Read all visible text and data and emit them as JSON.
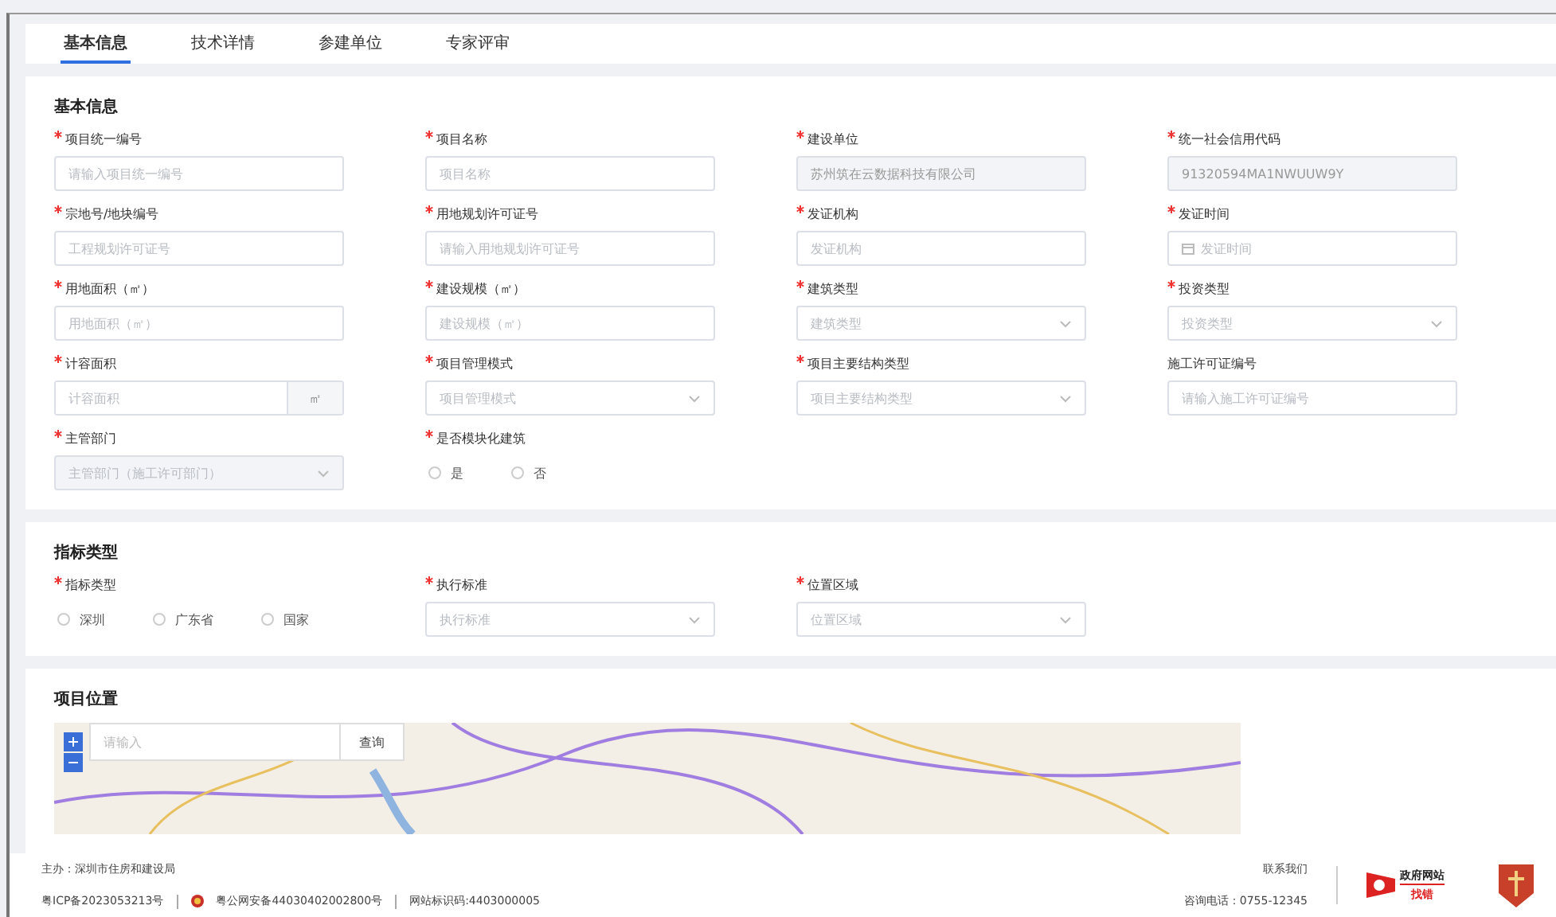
{
  "tabs": [
    {
      "label": "基本信息",
      "selected": true
    },
    {
      "label": "技术详情",
      "selected": false
    },
    {
      "label": "参建单位",
      "selected": false
    },
    {
      "label": "专家评审",
      "selected": false
    }
  ],
  "basic": {
    "title": "基本信息",
    "fields": [
      {
        "kind": "text",
        "label": "项目统一编号",
        "required": true,
        "placeholder": "请输入项目统一编号"
      },
      {
        "kind": "text",
        "label": "项目名称",
        "required": true,
        "placeholder": "项目名称"
      },
      {
        "kind": "disabled",
        "label": "建设单位",
        "required": true,
        "value": "苏州筑在云数据科技有限公司"
      },
      {
        "kind": "disabled",
        "label": "统一社会信用代码",
        "required": true,
        "value": "91320594MA1NWUUW9Y"
      },
      {
        "kind": "text",
        "label": "宗地号/地块编号",
        "required": true,
        "placeholder": "工程规划许可证号"
      },
      {
        "kind": "text",
        "label": "用地规划许可证号",
        "required": true,
        "placeholder": "请输入用地规划许可证号"
      },
      {
        "kind": "text",
        "label": "发证机构",
        "required": true,
        "placeholder": "发证机构"
      },
      {
        "kind": "date",
        "label": "发证时间",
        "required": true,
        "placeholder": "发证时间"
      },
      {
        "kind": "text",
        "label": "用地面积（㎡）",
        "required": true,
        "placeholder": "用地面积（㎡）"
      },
      {
        "kind": "text",
        "label": "建设规模（㎡）",
        "required": true,
        "placeholder": "建设规模（㎡）"
      },
      {
        "kind": "select",
        "label": "建筑类型",
        "required": true,
        "placeholder": "建筑类型"
      },
      {
        "kind": "select",
        "label": "投资类型",
        "required": true,
        "placeholder": "投资类型"
      },
      {
        "kind": "unit",
        "label": "计容面积",
        "required": true,
        "placeholder": "计容面积",
        "unit": "㎡"
      },
      {
        "kind": "select",
        "label": "项目管理模式",
        "required": true,
        "placeholder": "项目管理模式"
      },
      {
        "kind": "select",
        "label": "项目主要结构类型",
        "required": true,
        "placeholder": "项目主要结构类型"
      },
      {
        "kind": "text",
        "label": "施工许可证编号",
        "required": false,
        "placeholder": "请输入施工许可证编号"
      },
      {
        "kind": "select-disabled",
        "label": "主管部门",
        "required": true,
        "placeholder": "主管部门（施工许可部门）"
      },
      {
        "kind": "radio",
        "label": "是否模块化建筑",
        "required": true,
        "options": [
          {
            "label": "是",
            "selected": false
          },
          {
            "label": "否",
            "selected": false
          }
        ]
      }
    ]
  },
  "indicator": {
    "title": "指标类型",
    "fields": [
      {
        "kind": "radio",
        "label": "指标类型",
        "required": true,
        "options": [
          {
            "label": "深圳",
            "selected": false
          },
          {
            "label": "广东省",
            "selected": false
          },
          {
            "label": "国家",
            "selected": false
          }
        ]
      },
      {
        "kind": "select",
        "label": "执行标准",
        "required": true,
        "placeholder": "执行标准"
      },
      {
        "kind": "select",
        "label": "位置区域",
        "required": true,
        "placeholder": "位置区域"
      }
    ]
  },
  "location": {
    "title": "项目位置",
    "search_placeholder": "请输入",
    "search_button": "查询"
  },
  "footer": {
    "host": "主办：深圳市住房和建设局",
    "icp": "粤ICP备2023053213号",
    "police": "粤公网安备44030402002800号",
    "site_code": "网站标识码:4403000005",
    "contact": "联系我们",
    "phone": "咨询电话：0755-12345",
    "badge_top": "政府网站",
    "badge_bottom": "找错"
  }
}
